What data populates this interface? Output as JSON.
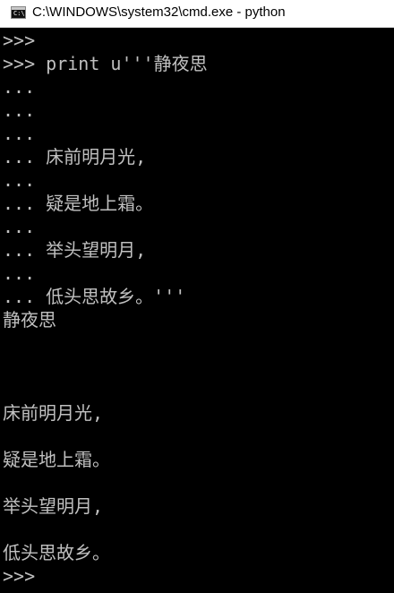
{
  "window": {
    "title": "C:\\WINDOWS\\system32\\cmd.exe - python",
    "icon": "console-app-icon"
  },
  "console": {
    "lines": [
      ">>>",
      ">>> print u'''静夜思",
      "...",
      "...",
      "...",
      "... 床前明月光,",
      "...",
      "... 疑是地上霜。",
      "...",
      "... 举头望明月,",
      "...",
      "... 低头思故乡。'''",
      "静夜思",
      "",
      "",
      "",
      "床前明月光,",
      "",
      "疑是地上霜。",
      "",
      "举头望明月,",
      "",
      "低头思故乡。",
      ">>>"
    ],
    "text_color": "#c0c0c0",
    "background": "#000000"
  }
}
